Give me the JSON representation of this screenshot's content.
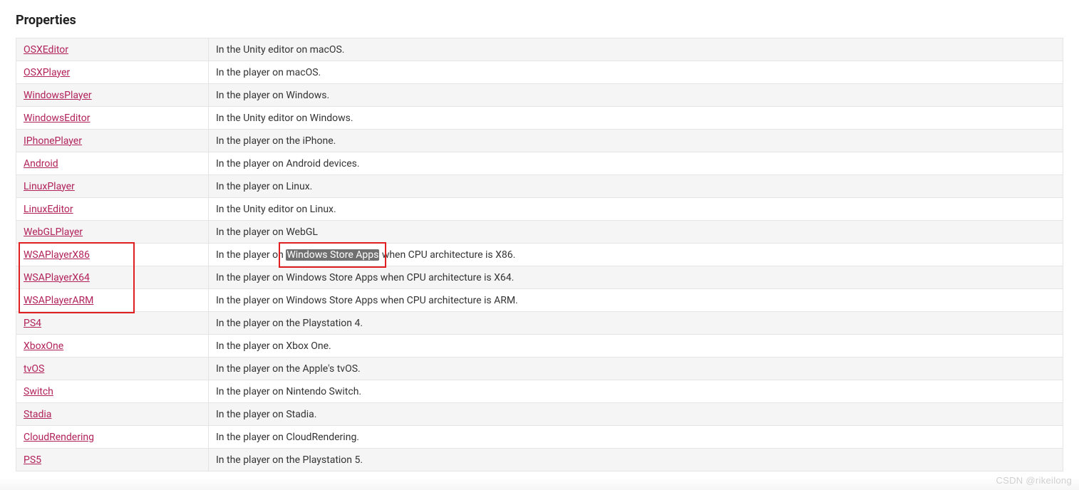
{
  "heading": "Properties",
  "watermark": "CSDN @rikeilong",
  "highlighted_phrase": "Windows Store Apps",
  "rows": [
    {
      "name": "OSXEditor",
      "desc": "In the Unity editor on macOS."
    },
    {
      "name": "OSXPlayer",
      "desc": "In the player on macOS."
    },
    {
      "name": "WindowsPlayer",
      "desc": "In the player on Windows."
    },
    {
      "name": "WindowsEditor",
      "desc": "In the Unity editor on Windows."
    },
    {
      "name": "IPhonePlayer",
      "desc": "In the player on the iPhone."
    },
    {
      "name": "Android",
      "desc": "In the player on Android devices."
    },
    {
      "name": "LinuxPlayer",
      "desc": "In the player on Linux."
    },
    {
      "name": "LinuxEditor",
      "desc": "In the Unity editor on Linux."
    },
    {
      "name": "WebGLPlayer",
      "desc": "In the player on WebGL"
    },
    {
      "name": "WSAPlayerX86",
      "desc": "In the player on Windows Store Apps when CPU architecture is X86.",
      "highlight": "Windows Store Apps"
    },
    {
      "name": "WSAPlayerX64",
      "desc": "In the player on Windows Store Apps when CPU architecture is X64."
    },
    {
      "name": "WSAPlayerARM",
      "desc": "In the player on Windows Store Apps when CPU architecture is ARM."
    },
    {
      "name": "PS4",
      "desc": "In the player on the Playstation 4."
    },
    {
      "name": "XboxOne",
      "desc": "In the player on Xbox One."
    },
    {
      "name": "tvOS",
      "desc": "In the player on the Apple's tvOS."
    },
    {
      "name": "Switch",
      "desc": "In the player on Nintendo Switch."
    },
    {
      "name": "Stadia",
      "desc": "In the player on Stadia."
    },
    {
      "name": "CloudRendering",
      "desc": "In the player on CloudRendering."
    },
    {
      "name": "PS5",
      "desc": "In the player on the Playstation 5."
    }
  ],
  "annotations": {
    "name_box_rows": [
      10,
      11,
      12
    ],
    "desc_box_row": 10
  }
}
